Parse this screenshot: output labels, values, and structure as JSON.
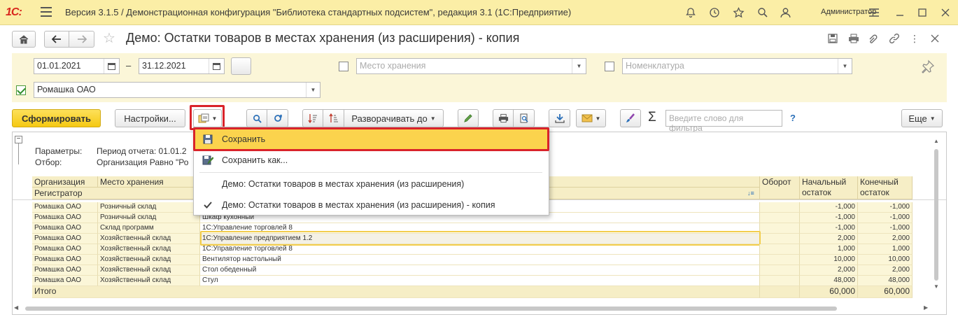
{
  "titlebar": {
    "logo": "1С:",
    "title": "Версия 3.1.5 / Демонстрационная конфигурация \"Библиотека стандартных подсистем\", редакция 3.1  (1С:Предприятие)",
    "user": "Администратор"
  },
  "form": {
    "title": "Демо: Остатки товаров в местах хранения (из расширения) - копия"
  },
  "settings": {
    "date_from": "01.01.2021",
    "date_dash": "–",
    "date_to": "31.12.2021",
    "storage_placeholder": "Место хранения",
    "nomenclature_placeholder": "Номенклатура",
    "organization": "Ромашка ОАО"
  },
  "toolbar": {
    "generate_label": "Сформировать",
    "settings_label": "Настройки...",
    "expand_label": "Разворачивать до",
    "sum_symbol": "Σ",
    "search_placeholder": "Введите слово для фильтра",
    "help_label": "?",
    "more_label": "Еще"
  },
  "report": {
    "params_label": "Параметры:",
    "params_value": "Период отчета: 01.01.2",
    "filter_label": "Отбор:",
    "filter_value": "Организация Равно \"Ро",
    "headers": {
      "org": "Организация",
      "place": "Место хранения",
      "registrar": "Регистратор",
      "turnover": "Оборот",
      "start": "Начальный остаток",
      "end": "Конечный остаток",
      "start_1": "Начальный",
      "start_2": "остаток",
      "end_1": "Конечный",
      "end_2": "остаток"
    },
    "rows": [
      {
        "org": "Ромашка ОАО",
        "place": "Розничный склад",
        "item": "",
        "start": "-1,000",
        "end": "-1,000"
      },
      {
        "org": "Ромашка ОАО",
        "place": "Розничный склад",
        "item": "Шкаф кухонный",
        "start": "-1,000",
        "end": "-1,000"
      },
      {
        "org": "Ромашка ОАО",
        "place": "Склад программ",
        "item": "1С:Управление торговлей 8",
        "start": "-1,000",
        "end": "-1,000"
      },
      {
        "org": "Ромашка ОАО",
        "place": "Хозяйственный склад",
        "item": "1С:Управление предприятием 1.2",
        "start": "2,000",
        "end": "2,000"
      },
      {
        "org": "Ромашка ОАО",
        "place": "Хозяйственный склад",
        "item": "1С:Управление торговлей 8",
        "start": "1,000",
        "end": "1,000"
      },
      {
        "org": "Ромашка ОАО",
        "place": "Хозяйственный склад",
        "item": "Вентилятор настольный",
        "start": "10,000",
        "end": "10,000"
      },
      {
        "org": "Ромашка ОАО",
        "place": "Хозяйственный склад",
        "item": "Стол обеденный",
        "start": "2,000",
        "end": "2,000"
      },
      {
        "org": "Ромашка ОАО",
        "place": "Хозяйственный склад",
        "item": "Стул",
        "start": "48,000",
        "end": "48,000"
      }
    ],
    "total": {
      "label": "Итого",
      "start": "60,000",
      "end": "60,000"
    }
  },
  "menu": {
    "items": [
      {
        "label": "Сохранить",
        "icon": "floppy-disk-icon",
        "selected": true
      },
      {
        "label": "Сохранить как...",
        "icon": "save-as-icon",
        "selected": false
      },
      {
        "label": "Демо: Остатки товаров в местах хранения (из расширения)",
        "icon": "",
        "selected": false
      },
      {
        "label": "Демо: Остатки товаров в местах хранения (из расширения) - копия",
        "icon": "checkmark-icon",
        "selected": false
      }
    ]
  },
  "colors": {
    "titlebar_bg": "#fbeea6",
    "panel_bg": "#fbf6d8",
    "primary_button": "#f5c912",
    "highlight_red": "#d9232a",
    "menu_selected": "#fbd34d"
  }
}
